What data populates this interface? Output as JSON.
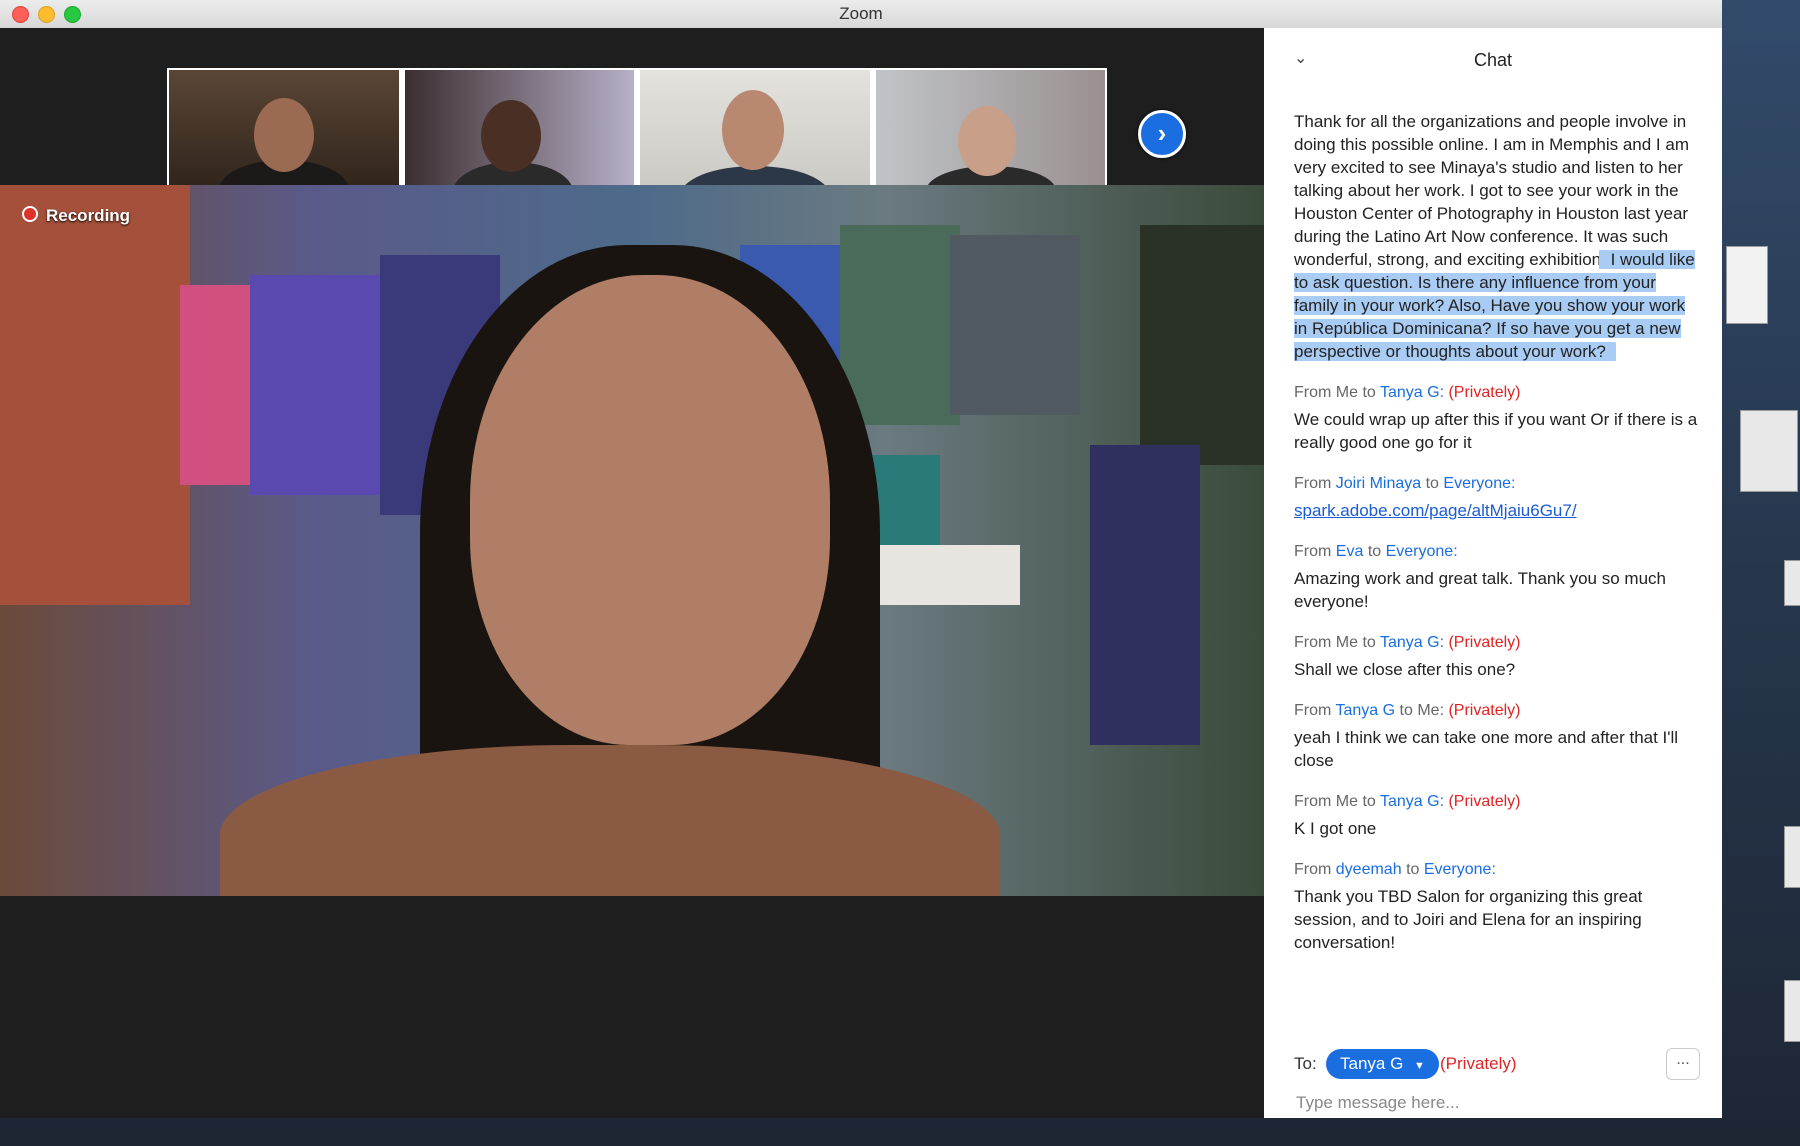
{
  "window": {
    "title": "Zoom"
  },
  "video": {
    "recording_label": "Recording"
  },
  "chat": {
    "title": "Chat",
    "messages": [
      {
        "text_plain": "Thank for all the organizations and people involve in doing this possible online. I am in Memphis and I am very excited to see Minaya's studio and listen to her talking about her work. I got to see your work in the Houston Center of Photography in Houston last year during the Latino Art Now conference. It was such wonderful, strong, and exciting exhibition. ",
        "text_highlighted": "I would like to ask question. Is there any influence from your family in your work?   Also, Have you show your work in República Dominicana? If so have you get a new perspective or thoughts about your work?"
      },
      {
        "prefix": "From",
        "from": "Me",
        "mid": "to",
        "to": "Tanya G",
        "suffix": ":",
        "private": "(Privately)",
        "text": "We could wrap up after this if you want Or if there is a really good one go for it"
      },
      {
        "prefix": "From",
        "from": "Joiri Minaya",
        "mid": "to",
        "to": "Everyone",
        "suffix": ":",
        "private": "",
        "link": "spark.adobe.com/page/altMjaiu6Gu7/"
      },
      {
        "prefix": "From",
        "from": "Eva",
        "mid": "to",
        "to": "Everyone",
        "suffix": ":",
        "private": "",
        "text": "Amazing work and great talk. Thank you so much everyone!"
      },
      {
        "prefix": "From",
        "from": "Me",
        "mid": "to",
        "to": "Tanya G",
        "suffix": ":",
        "private": "(Privately)",
        "text": "Shall we close after this one?"
      },
      {
        "prefix": "From",
        "from": "Tanya G",
        "mid": "to",
        "to": "Me",
        "suffix": ":",
        "private": "(Privately)",
        "text": "yeah I think we can take one more and after that I'll close"
      },
      {
        "prefix": "From",
        "from": "Me",
        "mid": "to",
        "to": "Tanya G",
        "suffix": ":",
        "private": "(Privately)",
        "text": "K I got one"
      },
      {
        "prefix": "From",
        "from": "dyeemah",
        "mid": "to",
        "to": "Everyone",
        "suffix": ":",
        "private": "",
        "text": "Thank you TBD Salon for organizing this great session, and to Joiri and Elena for an inspiring conversation!"
      }
    ],
    "footer": {
      "to_label": "To:",
      "recipient": "Tanya G",
      "private_label": "(Privately)",
      "more_label": "...",
      "input_placeholder": "Type message here..."
    }
  },
  "colors": {
    "accent": "#1a6ee0",
    "private": "#e02424",
    "highlight": "#a9ccf5"
  }
}
